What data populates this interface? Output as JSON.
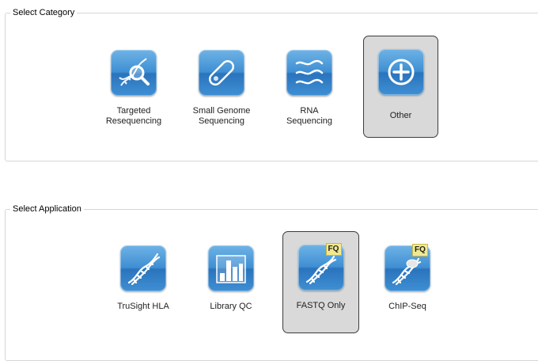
{
  "category_group": {
    "legend": "Select Category",
    "tiles": [
      {
        "label": "Targeted\nResequencing",
        "icon": "dna-magnifier-icon",
        "selected": false
      },
      {
        "label": "Small Genome\nSequencing",
        "icon": "capsule-icon",
        "selected": false
      },
      {
        "label": "RNA\nSequencing",
        "icon": "rna-strands-icon",
        "selected": false
      },
      {
        "label": "Other",
        "icon": "plus-circle-icon",
        "selected": true
      }
    ]
  },
  "application_group": {
    "legend": "Select Application",
    "tiles": [
      {
        "label": "TruSight HLA",
        "icon": "dna-helix-icon",
        "selected": false
      },
      {
        "label": "Library QC",
        "icon": "bar-chart-icon",
        "selected": false
      },
      {
        "label": "FASTQ Only",
        "icon": "dna-fastq-icon",
        "badge": "FQ",
        "selected": true
      },
      {
        "label": "ChIP-Seq",
        "icon": "dna-chip-fastq-icon",
        "badge": "FQ",
        "selected": false
      }
    ]
  },
  "colors": {
    "icon_blue": "#3f8fd3",
    "selected_bg": "#d9d9d9",
    "selected_border": "#3c3c3c",
    "fq_badge": "#f2e98f"
  }
}
